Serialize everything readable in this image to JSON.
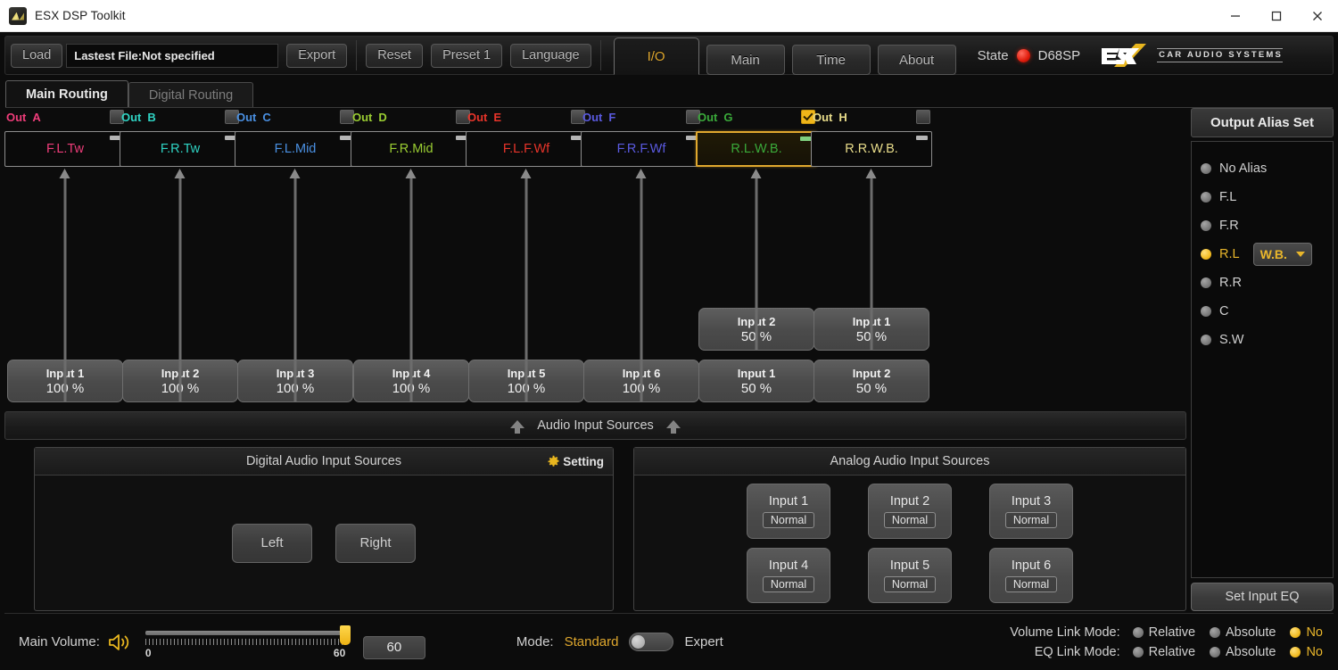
{
  "window": {
    "title": "ESX DSP Toolkit",
    "icon": "app-logo-icon",
    "minimize": "minimize-icon",
    "maximize": "maximize-icon",
    "close": "close-icon"
  },
  "toolbar": {
    "load_label": "Load",
    "file_field_value": "Lastest File:Not specified",
    "export_label": "Export",
    "reset_label": "Reset",
    "preset_label": "Preset 1",
    "language_label": "Language",
    "nav_tabs": [
      {
        "label": "I/O",
        "active": true
      },
      {
        "label": "Main",
        "active": false
      },
      {
        "label": "Time",
        "active": false
      },
      {
        "label": "About",
        "active": false
      }
    ],
    "state_label": "State",
    "state_color": "#e01c0c",
    "model": "D68SP",
    "brand": "ESX",
    "brand_sub": "CAR AUDIO SYSTEMS"
  },
  "subtabs": [
    {
      "label": "Main Routing",
      "active": true
    },
    {
      "label": "Digital Routing",
      "active": false
    }
  ],
  "routing": {
    "out_prefix": "Out",
    "channels": [
      {
        "letter": "A",
        "color": "#ef3d7a",
        "name": "F.L.Tw",
        "selected": false,
        "checked": false,
        "inputs": [
          {
            "name": "Input 1",
            "pct": "100 %"
          }
        ]
      },
      {
        "letter": "B",
        "color": "#2fd4c4",
        "name": "F.R.Tw",
        "selected": false,
        "checked": false,
        "inputs": [
          {
            "name": "Input 2",
            "pct": "100 %"
          }
        ]
      },
      {
        "letter": "C",
        "color": "#4a90e2",
        "name": "F.L.Mid",
        "selected": false,
        "checked": false,
        "inputs": [
          {
            "name": "Input 3",
            "pct": "100 %"
          }
        ]
      },
      {
        "letter": "D",
        "color": "#9acd32",
        "name": "F.R.Mid",
        "selected": false,
        "checked": false,
        "inputs": [
          {
            "name": "Input 4",
            "pct": "100 %"
          }
        ]
      },
      {
        "letter": "E",
        "color": "#e8342a",
        "name": "F.L.F.Wf",
        "selected": false,
        "checked": false,
        "inputs": [
          {
            "name": "Input 5",
            "pct": "100 %"
          }
        ]
      },
      {
        "letter": "F",
        "color": "#5a5ae0",
        "name": "F.R.F.Wf",
        "selected": false,
        "checked": false,
        "inputs": [
          {
            "name": "Input 6",
            "pct": "100 %"
          }
        ]
      },
      {
        "letter": "G",
        "color": "#3aa93a",
        "name": "R.L.W.B.",
        "selected": true,
        "checked": true,
        "inputs": [
          {
            "name": "Input 2",
            "pct": "50 %"
          },
          {
            "name": "Input 1",
            "pct": "50 %"
          }
        ]
      },
      {
        "letter": "H",
        "color": "#e8dc8a",
        "name": "R.R.W.B.",
        "selected": false,
        "checked": false,
        "inputs": [
          {
            "name": "Input 1",
            "pct": "50 %"
          },
          {
            "name": "Input 2",
            "pct": "50 %"
          }
        ]
      }
    ]
  },
  "audio_sources": {
    "bar_title": "Audio Input Sources",
    "digital": {
      "title": "Digital Audio Input Sources",
      "setting_label": "Setting",
      "setting_icon": "gear-icon",
      "buttons": [
        "Left",
        "Right"
      ]
    },
    "analog": {
      "title": "Analog Audio Input Sources",
      "inputs": [
        {
          "name": "Input 1",
          "mode": "Normal"
        },
        {
          "name": "Input 2",
          "mode": "Normal"
        },
        {
          "name": "Input 3",
          "mode": "Normal"
        },
        {
          "name": "Input 4",
          "mode": "Normal"
        },
        {
          "name": "Input 5",
          "mode": "Normal"
        },
        {
          "name": "Input 6",
          "mode": "Normal"
        }
      ]
    }
  },
  "sidebar": {
    "title": "Output Alias Set",
    "options": [
      {
        "label": "No Alias",
        "selected": false
      },
      {
        "label": "F.L",
        "selected": false
      },
      {
        "label": "F.R",
        "selected": false
      },
      {
        "label": "R.L",
        "selected": true,
        "dropdown": "W.B."
      },
      {
        "label": "R.R",
        "selected": false
      },
      {
        "label": "C",
        "selected": false
      },
      {
        "label": "S.W",
        "selected": false
      }
    ],
    "set_input_eq": "Set Input EQ"
  },
  "bottom": {
    "volume_label": "Main Volume:",
    "volume_icon": "speaker-icon",
    "volume_value": "60",
    "volume_min_tick": "0",
    "volume_max_tick": "60",
    "mode_label": "Mode:",
    "mode_standard": "Standard",
    "mode_expert": "Expert",
    "mode_active": "Standard",
    "volume_link": {
      "title": "Volume Link Mode:",
      "options": [
        {
          "label": "Relative",
          "selected": false
        },
        {
          "label": "Absolute",
          "selected": false
        },
        {
          "label": "No",
          "selected": true
        }
      ]
    },
    "eq_link": {
      "title": "EQ Link Mode:",
      "options": [
        {
          "label": "Relative",
          "selected": false
        },
        {
          "label": "Absolute",
          "selected": false
        },
        {
          "label": "No",
          "selected": true
        }
      ]
    }
  }
}
